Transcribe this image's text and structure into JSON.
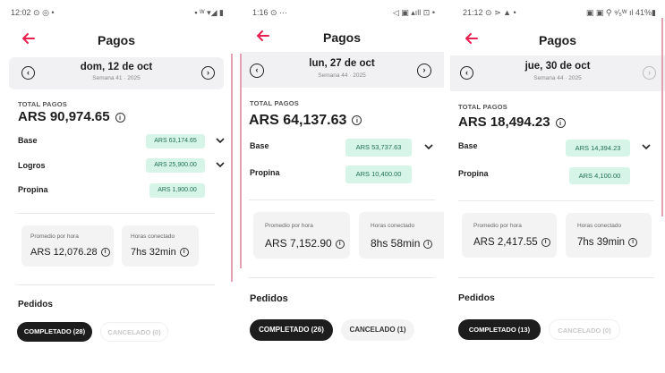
{
  "theme": {
    "accent": "#e8204f",
    "pill_bg": "#d6f5e8",
    "pill_text": "#1f6f55",
    "chip_active": "#1d1d1d"
  },
  "screens": [
    {
      "status_left": "12:02 ⊙ ◎ •",
      "status_right": "▪ ᵂ ▾◢ ▮",
      "title": "Pagos",
      "date": "dom, 12 de oct",
      "week": "Semana 41 · 2025",
      "total_label": "TOTAL PAGOS",
      "total": "ARS 90,974.65",
      "rows": [
        {
          "label": "Base",
          "amount": "ARS 63,174.65"
        },
        {
          "label": "Logros",
          "amount": "ARS 25,900.00"
        },
        {
          "label": "Propina",
          "amount": "ARS 1,900.00"
        }
      ],
      "stats": [
        {
          "label": "Promedio por hora",
          "value": "ARS 12,076.28"
        },
        {
          "label": "Horas conectado",
          "value": "7hs 32min"
        }
      ],
      "orders_title": "Pedidos",
      "chips": [
        "COMPLETADO (28)",
        "CANCELADO (0)"
      ]
    },
    {
      "status_left": "1:16 ⊙ ···",
      "status_right": "◁ ▣ ▴ıll ⊡ •",
      "title": "Pagos",
      "date": "lun, 27 de oct",
      "week": "Semana 44 · 2025",
      "total_label": "TOTAL PAGOS",
      "total": "ARS 64,137.63",
      "rows": [
        {
          "label": "Base",
          "amount": "ARS 53,737.63"
        },
        {
          "label": "Propina",
          "amount": "ARS 10,400.00"
        }
      ],
      "stats": [
        {
          "label": "Promedio por hora",
          "value": "ARS 7,152.90"
        },
        {
          "label": "Horas conectado",
          "value": "8hs 58min"
        }
      ],
      "orders_title": "Pedidos",
      "chips": [
        "COMPLETADO (26)",
        "CANCELADO (1)"
      ]
    },
    {
      "status_left": "21:12 ⊙ ⋗ ▲ •",
      "status_right": "▣ ▣ ⚲ ⁹⁄₅ᵂ ıl 41%▮",
      "title": "Pagos",
      "date": "jue, 30 de oct",
      "week": "Semana 44 · 2025",
      "total_label": "TOTAL PAGOS",
      "total": "ARS 18,494.23",
      "rows": [
        {
          "label": "Base",
          "amount": "ARS 14,394.23"
        },
        {
          "label": "Propina",
          "amount": "ARS 4,100.00"
        }
      ],
      "stats": [
        {
          "label": "Promedio por hora",
          "value": "ARS 2,417.55"
        },
        {
          "label": "Horas conectado",
          "value": "7hs 39min"
        }
      ],
      "orders_title": "Pedidos",
      "chips": [
        "COMPLETADO (13)",
        "CANCELADO (0)"
      ]
    }
  ]
}
